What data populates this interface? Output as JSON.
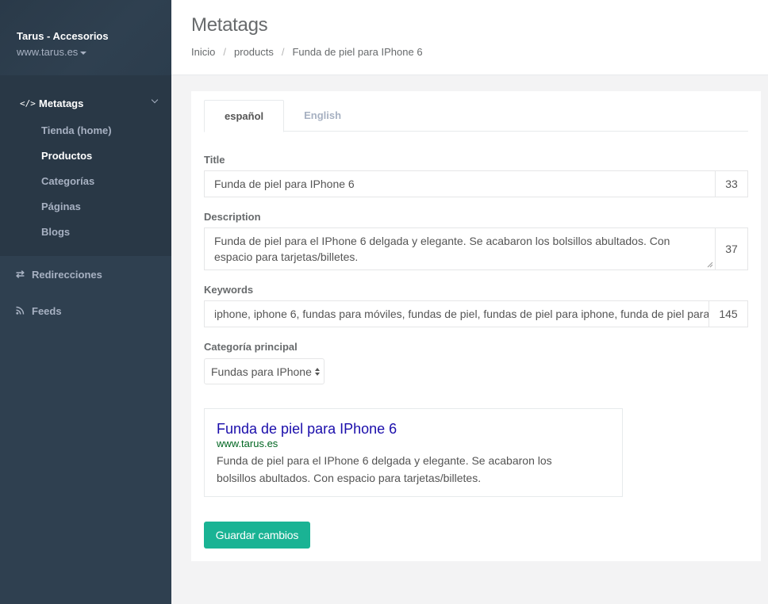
{
  "sidebar": {
    "store_name": "Tarus - Accesorios",
    "store_domain": "www.tarus.es",
    "section": {
      "icon": "code-icon",
      "label": "Metatags",
      "glyph": "</>"
    },
    "subitems": [
      {
        "label": "Tienda (home)",
        "current": false
      },
      {
        "label": "Productos",
        "current": true
      },
      {
        "label": "Categorías",
        "current": false
      },
      {
        "label": "Páginas",
        "current": false
      },
      {
        "label": "Blogs",
        "current": false
      }
    ],
    "items": [
      {
        "icon": "exchange-icon",
        "glyph": "⇄",
        "label": "Redirecciones"
      },
      {
        "icon": "rss-icon",
        "glyph": "",
        "label": "Feeds"
      }
    ]
  },
  "header": {
    "title": "Metatags",
    "breadcrumb": [
      "Inicio",
      "products",
      "Funda de piel para IPhone 6"
    ]
  },
  "tabs": [
    {
      "label": "español",
      "active": true
    },
    {
      "label": "English",
      "active": false
    }
  ],
  "form": {
    "title_label": "Title",
    "title_value": "Funda de piel para IPhone 6",
    "title_count": "33",
    "description_label": "Description",
    "description_value": "Funda de piel para el IPhone 6 delgada y elegante. Se acabaron los bolsillos abultados. Con espacio para tarjetas/billetes.",
    "description_count": "37",
    "keywords_label": "Keywords",
    "keywords_value": "iphone, iphone 6, fundas para móviles, fundas de piel, fundas de piel para iphone, funda de piel para",
    "keywords_count": "145",
    "category_label": "Categoría principal",
    "category_value": "Fundas para IPhone"
  },
  "preview": {
    "title": "Funda de piel para IPhone 6",
    "url": "www.tarus.es",
    "description": "Funda de piel para el IPhone 6 delgada y elegante. Se acabaron los bolsillos abultados. Con espacio para tarjetas/billetes."
  },
  "save_label": "Guardar cambios",
  "colors": {
    "sidebar_bg": "#2f4050",
    "sidebar_active_bg": "#293846",
    "primary_button": "#1ab394",
    "preview_title": "#1a0dab",
    "preview_url": "#006621"
  }
}
